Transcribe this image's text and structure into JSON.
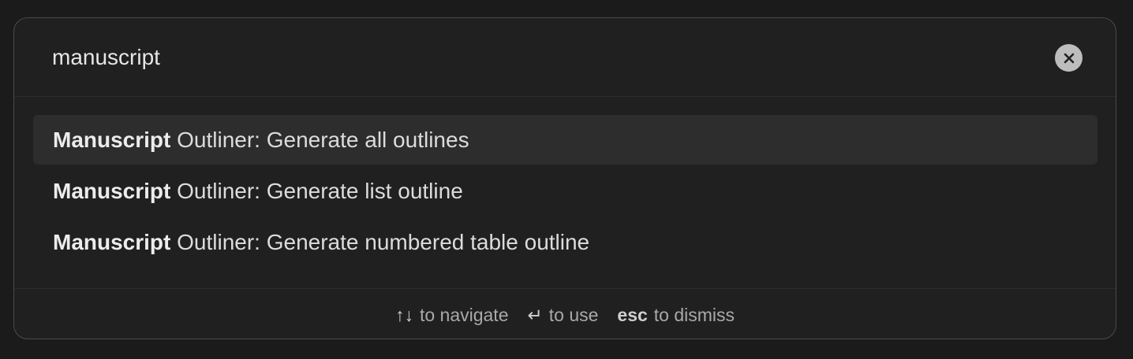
{
  "search": {
    "value": "manuscript",
    "clear_icon": "close-icon"
  },
  "results": [
    {
      "match": "Manuscript",
      "rest": " Outliner: Generate all outlines",
      "selected": true
    },
    {
      "match": "Manuscript",
      "rest": " Outliner: Generate list outline",
      "selected": false
    },
    {
      "match": "Manuscript",
      "rest": " Outliner: Generate numbered table outline",
      "selected": false
    }
  ],
  "footer": {
    "navigate_key": "↑↓",
    "navigate_label": "to navigate",
    "use_key": "↵",
    "use_label": "to use",
    "dismiss_key": "esc",
    "dismiss_label": "to dismiss"
  },
  "colors": {
    "background": "#1b1b1b",
    "modal_background": "#202020",
    "selected_row": "#2d2d2d",
    "text": "#e0e0e0",
    "muted_text": "#a9a9a9"
  }
}
